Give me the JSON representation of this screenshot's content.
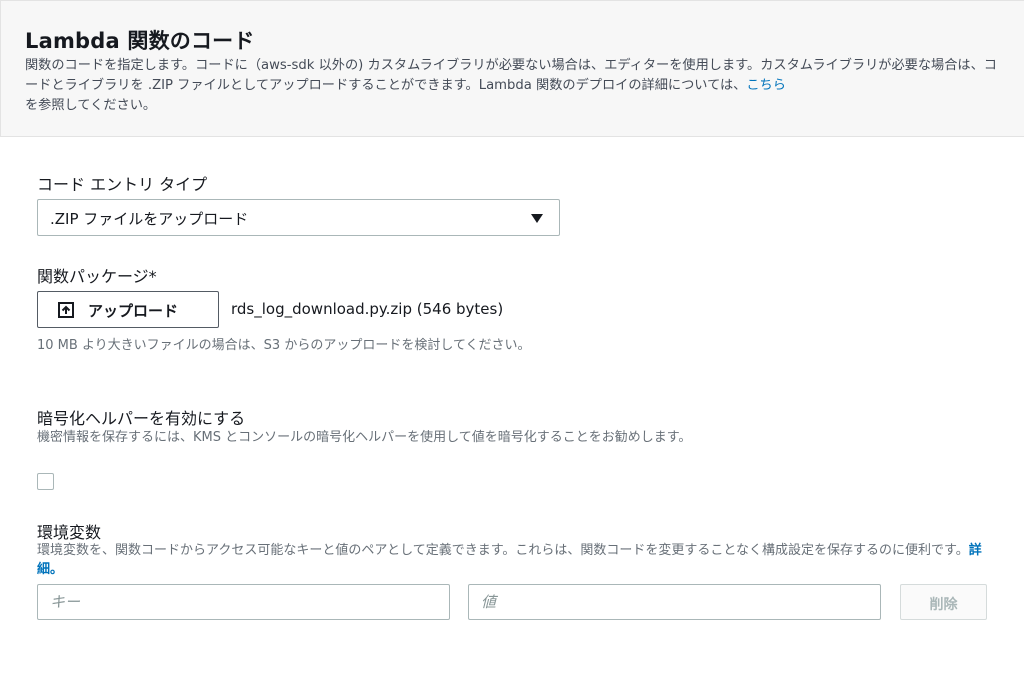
{
  "panel": {
    "title": "Lambda 関数のコード",
    "description": "関数のコードを指定します。コードに（aws-sdk 以外の) カスタムライブラリが必要ない場合は、エディターを使用します。カスタムライブラリが必要な場合は、コードとライブラリを .ZIP ファイルとしてアップロードすることができます。Lambda 関数のデプロイの詳細については、",
    "link_text": "こちら",
    "description_tail": "を参照してください。"
  },
  "code_entry": {
    "label": "コード エントリ タイプ",
    "selected": ".ZIP ファイルをアップロード"
  },
  "package": {
    "label": "関数パッケージ*",
    "upload_label": "アップロード",
    "file_name": "rds_log_download.py.zip (546 bytes)",
    "hint": "10 MB より大きいファイルの場合は、S3 からのアップロードを検討してください。"
  },
  "encryption": {
    "label": "暗号化ヘルパーを有効にする",
    "description": "機密情報を保存するには、KMS とコンソールの暗号化ヘルパーを使用して値を暗号化することをお勧めします。",
    "checked": false
  },
  "env": {
    "label": "環境変数",
    "description": "環境変数を、関数コードからアクセス可能なキーと値のペアとして定義できます。これらは、関数コードを変更することなく構成設定を保存するのに便利です。",
    "link_text": "詳細。",
    "key_placeholder": "キー",
    "value_placeholder": "値",
    "delete_label": "削除"
  },
  "icons": {
    "upload": "upload-icon",
    "dropdown": "caret-down-icon"
  },
  "colors": {
    "link": "#0073bb",
    "panel_bg": "#f7f7f7"
  }
}
